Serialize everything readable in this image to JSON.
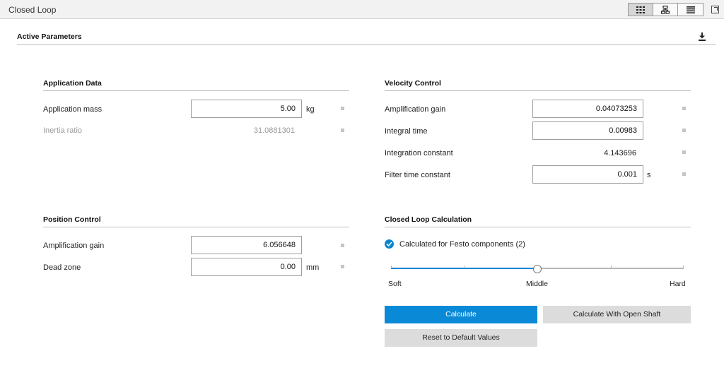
{
  "window": {
    "title": "Closed Loop"
  },
  "toolbar": {
    "view_icons": [
      "grid-view-icon",
      "structure-view-icon",
      "list-view-icon"
    ],
    "popout_icon": "popout-icon"
  },
  "header": {
    "title": "Active Parameters",
    "download_icon": "download-icon"
  },
  "application_data": {
    "title": "Application Data",
    "mass_label": "Application mass",
    "mass_value": "5.00",
    "mass_unit": "kg",
    "inertia_label": "Inertia ratio",
    "inertia_value": "31.0881301"
  },
  "position_control": {
    "title": "Position Control",
    "gain_label": "Amplification gain",
    "gain_value": "6.056648",
    "deadzone_label": "Dead zone",
    "deadzone_value": "0.00",
    "deadzone_unit": "mm"
  },
  "velocity_control": {
    "title": "Velocity Control",
    "gain_label": "Amplification gain",
    "gain_value": "0.04073253",
    "integral_label": "Integral time",
    "integral_value": "0.00983",
    "constant_label": "Integration constant",
    "constant_value": "4.143696",
    "filter_label": "Filter time constant",
    "filter_value": "0.001",
    "filter_unit": "s"
  },
  "closed_loop_calc": {
    "title": "Closed Loop Calculation",
    "checkbox_label": "Calculated for Festo components (2)",
    "checkbox_checked": true,
    "slider": {
      "min_label": "Soft",
      "mid_label": "Middle",
      "max_label": "Hard",
      "value_fraction": 0.5,
      "ticks": 5
    },
    "calculate_label": "Calculate",
    "open_shaft_label": "Calculate With Open Shaft",
    "reset_label": "Reset to Default Values"
  },
  "colors": {
    "accent": "#0a8ad6",
    "checkbox": "#0a84d0",
    "button_secondary": "#dcdcdc"
  }
}
